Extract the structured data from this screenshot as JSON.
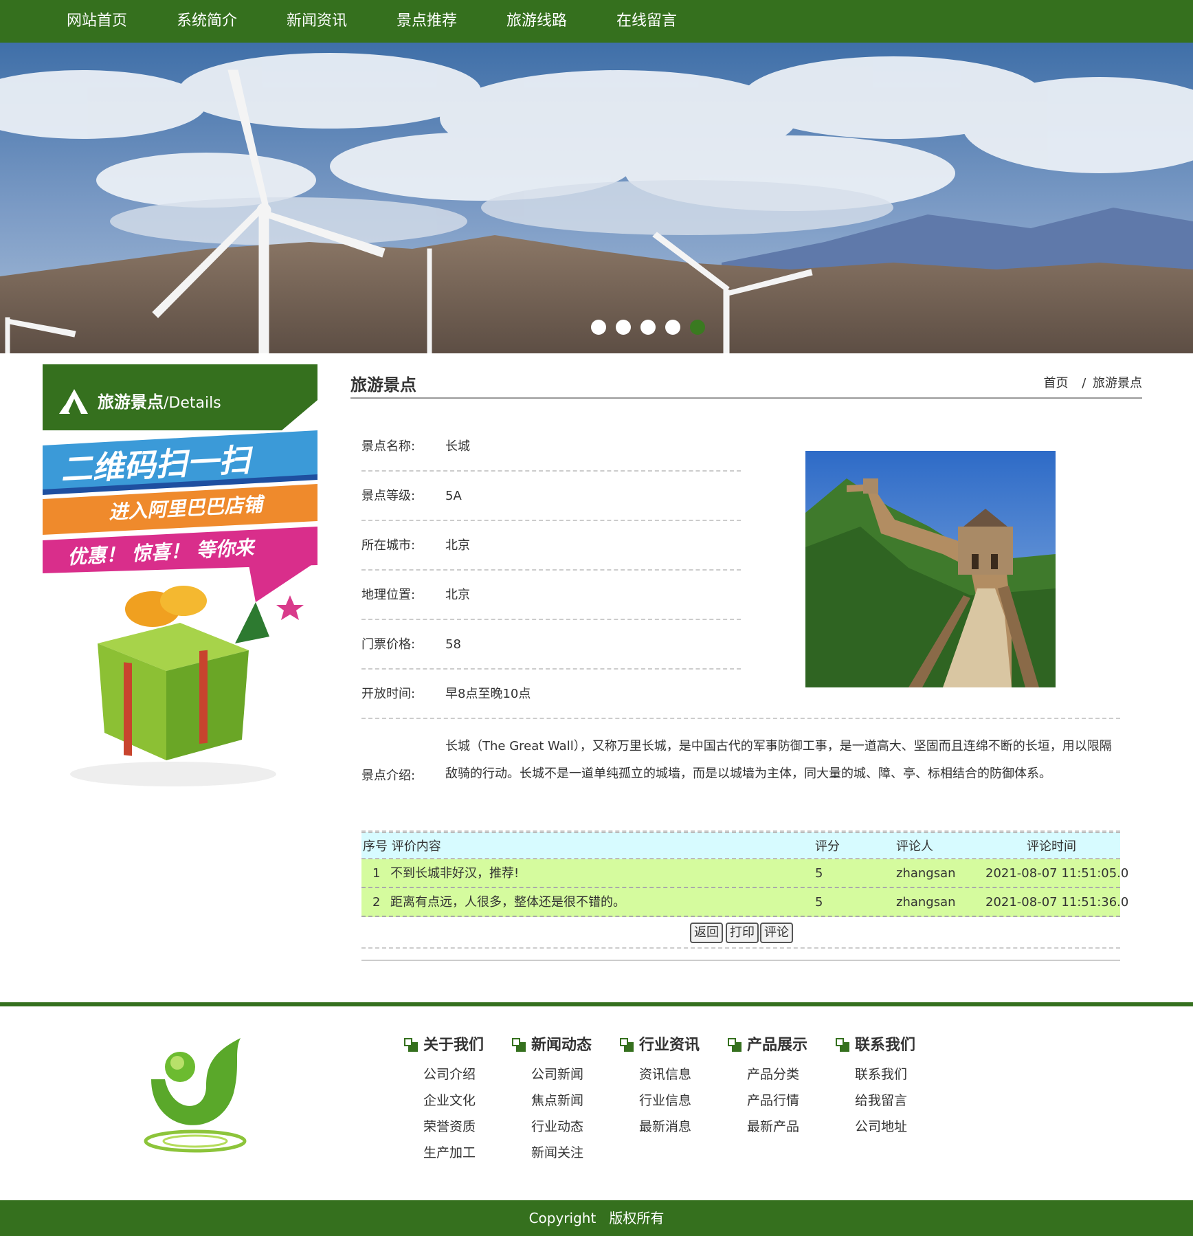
{
  "nav": {
    "items": [
      "网站首页",
      "系统简介",
      "新闻资讯",
      "景点推荐",
      "旅游线路",
      "在线留言"
    ]
  },
  "banner": {
    "slide_count": 5,
    "active_slide": 5,
    "colors": {
      "active_dot": "#3a7a20",
      "inactive_dot": "#ffffff"
    }
  },
  "sidebar": {
    "title": "旅游景点",
    "title_sub": "/Details",
    "promo": {
      "line1": "二维码扫一扫",
      "line2": "进入阿里巴巴店铺",
      "line3": "优惠！ 惊喜！ 等你来"
    }
  },
  "main": {
    "title": "旅游景点",
    "breadcrumb": {
      "home": "首页",
      "sep": "/",
      "current": "旅游景点"
    },
    "fields": [
      {
        "label": "景点名称:",
        "value": "长城"
      },
      {
        "label": "景点等级:",
        "value": "5A"
      },
      {
        "label": "所在城市:",
        "value": "北京"
      },
      {
        "label": "地理位置:",
        "value": "北京"
      },
      {
        "label": "门票价格:",
        "value": "58"
      },
      {
        "label": "开放时间:",
        "value": "早8点至晚10点"
      }
    ],
    "intro": {
      "label": "景点介绍:",
      "value": "长城（The Great Wall），又称万里长城，是中国古代的军事防御工事，是一道高大、坚固而且连绵不断的长垣，用以限隔敌骑的行动。长城不是一道单纯孤立的城墙，而是以城墙为主体，同大量的城、障、亭、标相结合的防御体系。"
    },
    "reviews": {
      "headers": {
        "index_content": "序号 评价内容",
        "score": "评分",
        "reviewer": "评论人",
        "time": "评论时间"
      },
      "rows": [
        {
          "index": "1",
          "content": "不到长城非好汉，推荐!",
          "score": "5",
          "reviewer": "zhangsan",
          "time": "2021-08-07 11:51:05.0"
        },
        {
          "index": "2",
          "content": "距离有点远，人很多，整体还是很不错的。",
          "score": "5",
          "reviewer": "zhangsan",
          "time": "2021-08-07 11:51:36.0"
        }
      ]
    },
    "buttons": {
      "back": "返回",
      "print": "打印",
      "comment": "评论"
    }
  },
  "footer": {
    "columns": [
      {
        "title": "关于我们",
        "links": [
          "公司介绍",
          "企业文化",
          "荣誉资质",
          "生产加工"
        ]
      },
      {
        "title": "新闻动态",
        "links": [
          "公司新闻",
          "焦点新闻",
          "行业动态",
          "新闻关注"
        ]
      },
      {
        "title": "行业资讯",
        "links": [
          "资讯信息",
          "行业信息",
          "最新消息"
        ]
      },
      {
        "title": "产品展示",
        "links": [
          "产品分类",
          "产品行情",
          "最新产品"
        ]
      },
      {
        "title": "联系我们",
        "links": [
          "联系我们",
          "给我留言",
          "公司地址"
        ]
      }
    ],
    "copyright": "Copyright   版权所有"
  },
  "colors": {
    "brand_green": "#35701e",
    "table_head": "#d7fbff",
    "table_row": "#d5fb9e"
  }
}
